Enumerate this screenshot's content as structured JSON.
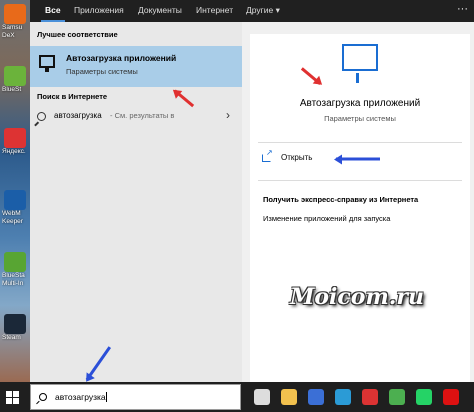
{
  "desktop": {
    "items": [
      {
        "label": "Samsu\nDeX",
        "icon": "samsung-dex-icon",
        "color": "#e86a1a"
      },
      {
        "label": "BlueSt",
        "icon": "bluestacks-icon",
        "color": "#6bb33b"
      },
      {
        "label": "Яндекс.",
        "icon": "yandex-browser-icon",
        "color": "#d33"
      },
      {
        "label": "WebM\nKeeper",
        "icon": "webmoney-keeper-icon",
        "color": "#1b5ea8"
      },
      {
        "label": "BlueSta\nMulti-In",
        "icon": "bluestacks-multi-instance-icon",
        "color": "#58a533"
      },
      {
        "label": "Steam",
        "icon": "steam-icon",
        "color": "#1b2838"
      }
    ]
  },
  "tabs": {
    "items": [
      {
        "label": "Все",
        "active": true
      },
      {
        "label": "Приложения"
      },
      {
        "label": "Документы"
      },
      {
        "label": "Интернет"
      },
      {
        "label": "Другие"
      }
    ],
    "more_icon": "ellipsis-icon"
  },
  "left": {
    "best_heading": "Лучшее соответствие",
    "best_title": "Автозагрузка приложений",
    "best_subtitle": "Параметры системы",
    "web_heading": "Поиск в Интернете",
    "web_query": "автозагрузка",
    "web_hint": "- См. результаты в"
  },
  "right": {
    "title": "Автозагрузка приложений",
    "subtitle": "Параметры системы",
    "open_label": "Открыть",
    "help_heading": "Получить экспресс-справку из Интернета",
    "help_link": "Изменение приложений для запуска"
  },
  "watermark": "Moicom.ru",
  "taskbar": {
    "search_value": "автозагрузка",
    "icons": [
      {
        "icon": "task-view-icon",
        "color": "#ddd"
      },
      {
        "icon": "file-explorer-icon",
        "color": "#f2c14e"
      },
      {
        "icon": "store-icon",
        "color": "#3b6fd6"
      },
      {
        "icon": "edge-icon",
        "color": "#2b9bd6"
      },
      {
        "icon": "yandex-browser-icon",
        "color": "#d33"
      },
      {
        "icon": "chrome-icon",
        "color": "#4caf50"
      },
      {
        "icon": "whatsapp-icon",
        "color": "#25d366"
      },
      {
        "icon": "opera-icon",
        "color": "#d11"
      }
    ]
  },
  "colors": {
    "accent": "#1a6dd2",
    "arrow_red": "#e03030",
    "arrow_blue": "#2b4fd8",
    "selection": "#a9cde8"
  }
}
